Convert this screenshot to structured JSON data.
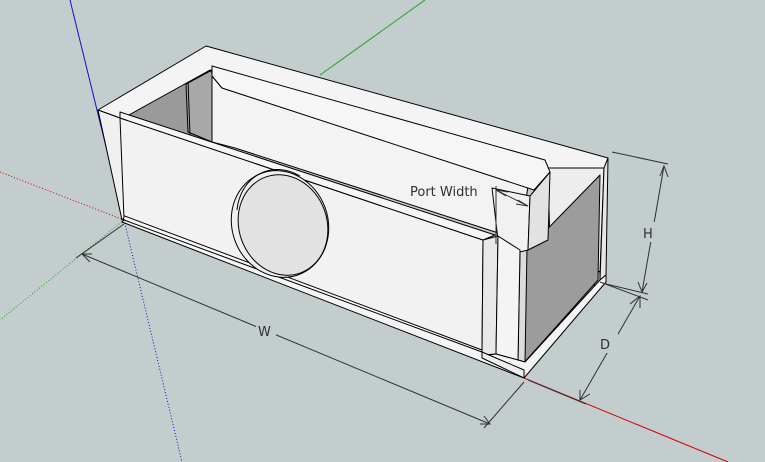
{
  "viewport": {
    "background": "#c3cdcd"
  },
  "axes": {
    "red_color": "#d40000",
    "green_color": "#1aa51a",
    "blue_color": "#1010c8"
  },
  "model": {
    "face_color": "#f2f2f2",
    "inner_color": "#e6e6e6",
    "shadow_color": "#9a9a9a",
    "hole_color": "#e4e4e4",
    "edge_color": "#000000"
  },
  "dimensions": {
    "width_label": "W",
    "depth_label": "D",
    "height_label": "H",
    "port_width_label": "Port Width"
  }
}
